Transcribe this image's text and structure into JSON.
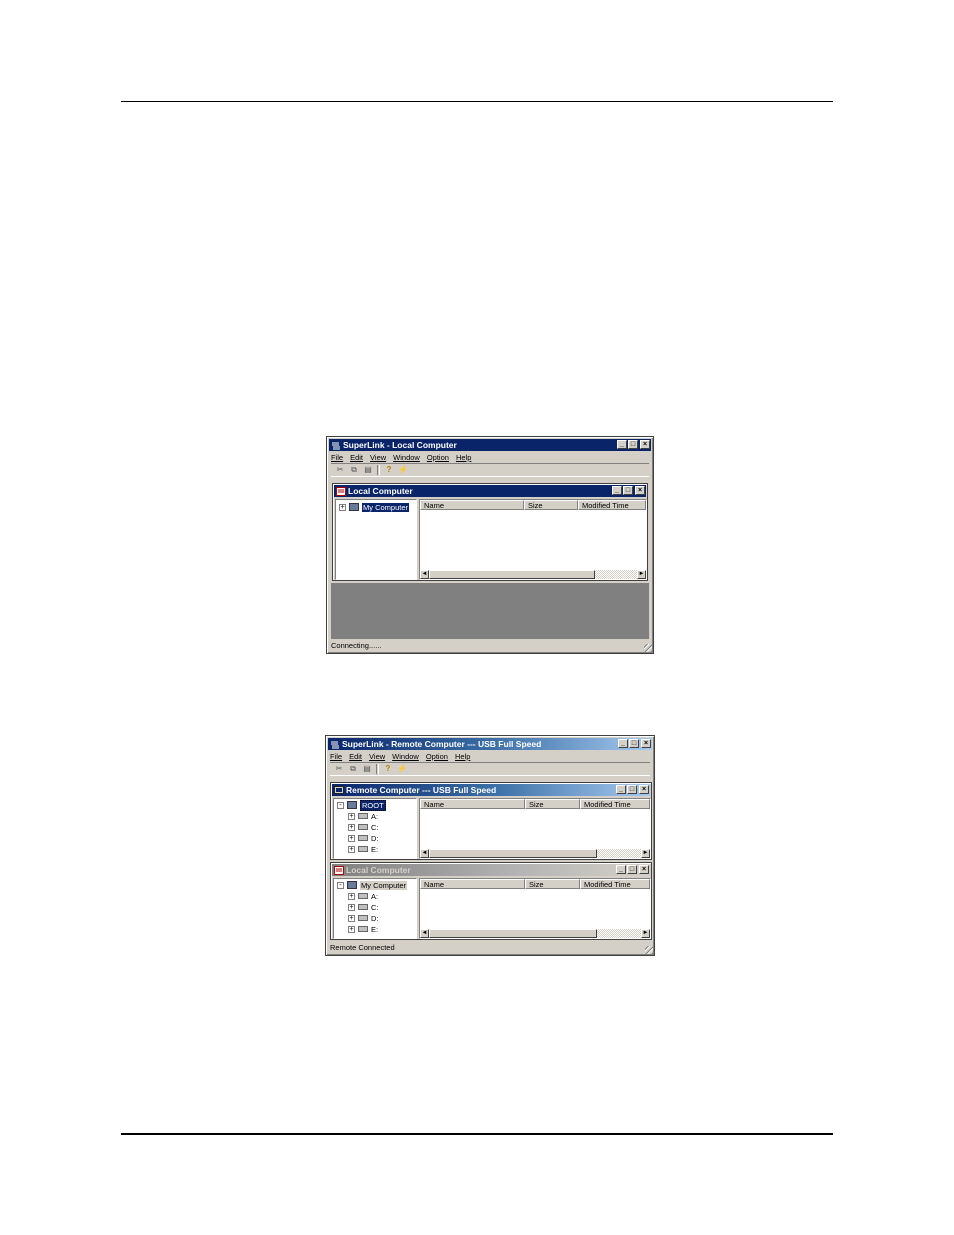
{
  "window1": {
    "title": "SuperLink - Local Computer",
    "menu": [
      "File",
      "Edit",
      "View",
      "Window",
      "Option",
      "Help"
    ],
    "local_panel": {
      "title": "Local Computer",
      "tree": [
        {
          "label": "My Computer",
          "expander": "+"
        }
      ],
      "columns": [
        "Name",
        "Size",
        "Modified Time"
      ]
    },
    "status": "Connecting......"
  },
  "window2": {
    "title": "SuperLink - Remote Computer --- USB Full Speed",
    "menu": [
      "File",
      "Edit",
      "View",
      "Window",
      "Option",
      "Help"
    ],
    "remote_panel": {
      "title": "Remote Computer --- USB Full Speed",
      "tree": [
        {
          "label": "ROOT",
          "expander": "-"
        },
        {
          "label": "A:",
          "expander": "+"
        },
        {
          "label": "C:",
          "expander": "+"
        },
        {
          "label": "D:",
          "expander": "+"
        },
        {
          "label": "E:",
          "expander": "+"
        }
      ],
      "columns": [
        "Name",
        "Size",
        "Modified Time"
      ]
    },
    "local_panel": {
      "title": "Local Computer",
      "tree": [
        {
          "label": "My Computer",
          "expander": "-"
        },
        {
          "label": "A:",
          "expander": "+"
        },
        {
          "label": "C:",
          "expander": "+"
        },
        {
          "label": "D:",
          "expander": "+"
        },
        {
          "label": "E:",
          "expander": "+"
        }
      ],
      "columns": [
        "Name",
        "Size",
        "Modified Time"
      ]
    },
    "status": "Remote Connected"
  },
  "glyphs": {
    "minimize": "_",
    "maximize": "□",
    "close": "×",
    "left": "◄",
    "right": "►"
  }
}
